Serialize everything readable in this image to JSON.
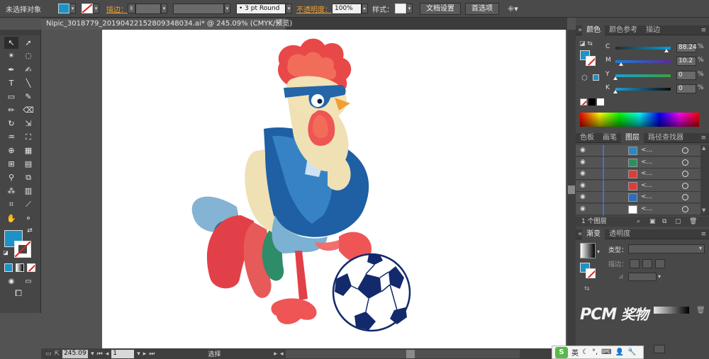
{
  "control_bar": {
    "selection_label": "未选择对象",
    "stroke_label": "描边：",
    "brush_value": "3 pt Round",
    "opacity_label": "不透明度：",
    "opacity_value": "100%",
    "style_label": "样式：",
    "doc_setup_label": "文档设置",
    "prefs_label": "首选项"
  },
  "document": {
    "tab_title": "Nipic_3018779_20190422152809348034.ai* @ 245.09% (CMYK/预览)",
    "close_glyph": "×"
  },
  "status_bar": {
    "zoom": "245.09",
    "page": "1",
    "status_text": "选择"
  },
  "color_panel": {
    "tabs": [
      "颜色",
      "颜色参考",
      "描边"
    ],
    "channels": [
      {
        "label": "C",
        "value": "88.24",
        "knob": 0.92,
        "color_from": "#2a2a2a",
        "color_to": "#00a0e0"
      },
      {
        "label": "M",
        "value": "10.2",
        "knob": 0.1,
        "color_from": "#1a7fd0",
        "color_to": "#5a2aa0"
      },
      {
        "label": "Y",
        "value": "0",
        "knob": 0.0,
        "color_from": "#17a0d0",
        "color_to": "#3aa040"
      },
      {
        "label": "K",
        "value": "0",
        "knob": 0.0,
        "color_from": "#1d9fd6",
        "color_to": "#0a0a0a"
      }
    ],
    "pct": "%"
  },
  "layers_panel": {
    "tabs": [
      "色板",
      "画笔",
      "图层",
      "路径查找器"
    ],
    "rows": [
      {
        "name": "<...",
        "thumb_color": "#2a87c4"
      },
      {
        "name": "<...",
        "thumb_color": "#2c8f60"
      },
      {
        "name": "<...",
        "thumb_color": "#e03a3a"
      },
      {
        "name": "<...",
        "thumb_color": "#e03a3a"
      },
      {
        "name": "<...",
        "thumb_color": "#2a6fb8"
      },
      {
        "name": "<...",
        "thumb_color": "#ffffff"
      }
    ],
    "footer": "1 个图层"
  },
  "gradient_panel": {
    "tabs": [
      "渐变",
      "透明度"
    ],
    "type_label": "类型：",
    "stroke_label": "描边："
  },
  "ime_bar": {
    "logo": "S",
    "lang": "英"
  },
  "watermark": "PCM 奖物",
  "colors": {
    "fill": "#1d92c6",
    "stroke": "#ffffff",
    "accent_orange": "#f0a030"
  }
}
